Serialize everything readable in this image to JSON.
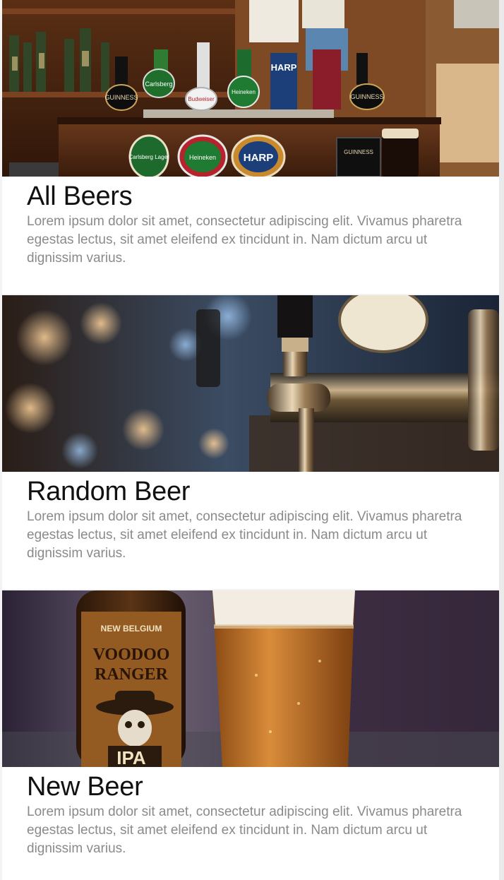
{
  "cards": [
    {
      "title": "All Beers",
      "description": "Lorem ipsum dolor sit amet, consectetur adipiscing elit. Vivamus pharetra egestas lectus, sit amet eleifend ex tincidunt in. Nam dictum arcu ut dignissim varius.",
      "image_labels": {
        "tap1": "GUINNESS",
        "tap2": "Carlsberg",
        "tap3": "Budweiser",
        "tap4": "Heineken",
        "tap5": "HARP",
        "tap6": "GUINNESS",
        "badge1": "Carlsberg Lager",
        "badge2": "Heineken",
        "badge3": "HARP",
        "badge4": "GUINNESS"
      }
    },
    {
      "title": "Random Beer",
      "description": "Lorem ipsum dolor sit amet, consectetur adipiscing elit. Vivamus pharetra egestas lectus, sit amet eleifend ex tincidunt in. Nam dictum arcu ut dignissim varius."
    },
    {
      "title": "New Beer",
      "description": "Lorem ipsum dolor sit amet, consectetur adipiscing elit. Vivamus pharetra egestas lectus, sit amet eleifend ex tincidunt in. Nam dictum arcu ut dignissim varius.",
      "image_labels": {
        "brand": "NEW BELGIUM",
        "line1": "VOODOO",
        "line2": "RANGER",
        "style": "IPA"
      }
    }
  ]
}
